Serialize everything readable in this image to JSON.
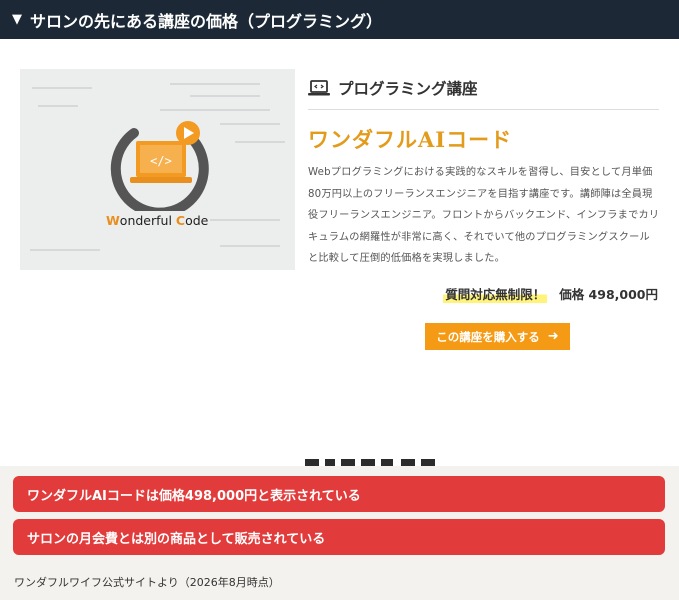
{
  "header": {
    "title": "サロンの先にある講座の価格（プログラミング）"
  },
  "course": {
    "category": "プログラミング講座",
    "title": "ワンダフルAIコード",
    "description": "Webプログラミングにおける実践的なスキルを習得し、目安として月単価80万円以上のフリーランスエンジニアを目指す講座です。講師陣は全員現役フリーランスエンジニア。フロントからバックエンド、インフラまでカリキュラムの網羅性が非常に高く、それでいて他のプログラミングスクールと比較して圧倒的低価格を実現しました。",
    "highlight": "質問対応無制限！",
    "price": "価格 498,000円",
    "buy_label": "この講座を購入する",
    "logo_w": "W",
    "logo_text1": "onderful ",
    "logo_c": "C",
    "logo_text2": "ode",
    "logo_code": "</>"
  },
  "callouts": [
    "ワンダフルAIコードは価格498,000円と表示されている",
    "サロンの月会費とは別の商品として販売されている"
  ],
  "source": "ワンダフルワイフ公式サイトより（2026年8月時点）",
  "colors": {
    "header_bg": "#1c2836",
    "accent_orange": "#f59a14",
    "title_orange": "#e39b1c",
    "callout_red": "#e23b3b",
    "highlight_yellow": "#fff37a"
  },
  "icons": {
    "header_marker": "triangle-down-icon",
    "category": "laptop-code-icon",
    "buy": "arrow-right-icon"
  }
}
